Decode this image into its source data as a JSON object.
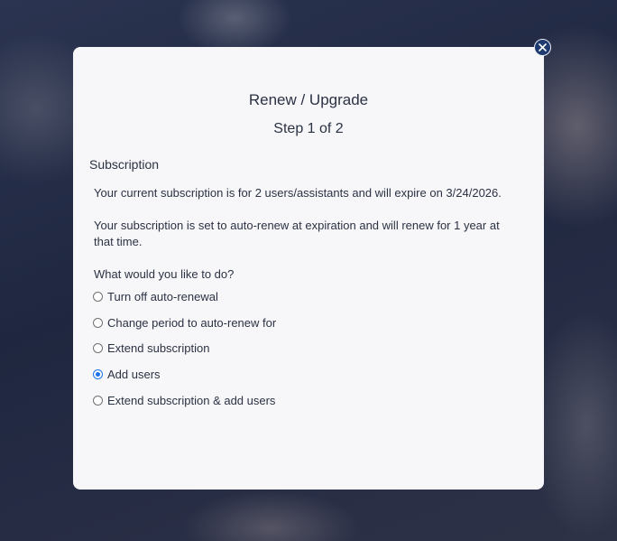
{
  "dialog": {
    "title": "Renew / Upgrade",
    "step": "Step 1 of 2",
    "section_label": "Subscription",
    "paragraph_1": "Your current subscription is for 2 users/assistants and will expire on 3/24/2026.",
    "paragraph_2": "Your subscription is set to auto-renew at expiration and will renew for 1 year at that time.",
    "question": "What would you like to do?",
    "options": [
      {
        "label": "Turn off auto-renewal",
        "selected": false
      },
      {
        "label": "Change period to auto-renew for",
        "selected": false
      },
      {
        "label": "Extend subscription",
        "selected": false
      },
      {
        "label": "Add users",
        "selected": true
      },
      {
        "label": "Extend subscription & add users",
        "selected": false
      }
    ],
    "close_icon": "close-icon"
  },
  "colors": {
    "accent": "#1a73e8",
    "close_button": "#1e3a6e",
    "modal_background": "#f7f7f9",
    "text": "#2b3244"
  }
}
